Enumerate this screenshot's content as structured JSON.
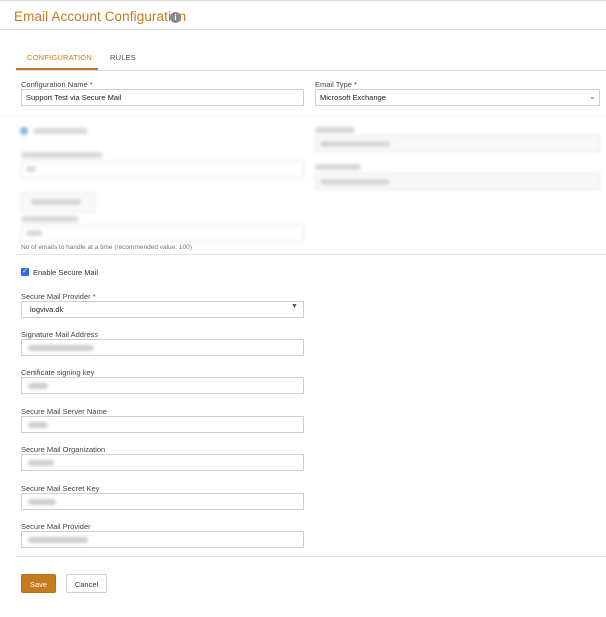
{
  "page": {
    "title": "Email Account Configuration",
    "info_icon": "info-icon"
  },
  "tabs": [
    {
      "label": "CONFIGURATION",
      "active": true
    },
    {
      "label": "RULES",
      "active": false
    }
  ],
  "form": {
    "config_name": {
      "label": "Configuration Name *",
      "value": "Support Test via Secure Mail"
    },
    "email_type": {
      "label": "Email Type *",
      "value": "Microsoft Exchange"
    },
    "batch_helper": "No of emails to handle at a time (recommended value: 100)",
    "enable_secure_mail": {
      "label": "Enable Secure Mail",
      "checked": true
    },
    "secure_mail_provider_select": {
      "label": "Secure Mail Provider *",
      "value": "logviva.dk"
    },
    "signature_mail_address": {
      "label": "Signature Mail Address"
    },
    "certificate_signing_key": {
      "label": "Certificate signing key"
    },
    "secure_mail_server_name": {
      "label": "Secure Mail Server Name"
    },
    "secure_mail_organization": {
      "label": "Secure Mail Organization"
    },
    "secure_mail_secret_key": {
      "label": "Secure Mail Secret Key"
    },
    "secure_mail_provider_text": {
      "label": "Secure Mail Provider"
    }
  },
  "actions": {
    "save_label": "Save",
    "cancel_label": "Cancel"
  },
  "colors": {
    "accent": "#c57a1e",
    "checkbox": "#2f6fd6"
  }
}
